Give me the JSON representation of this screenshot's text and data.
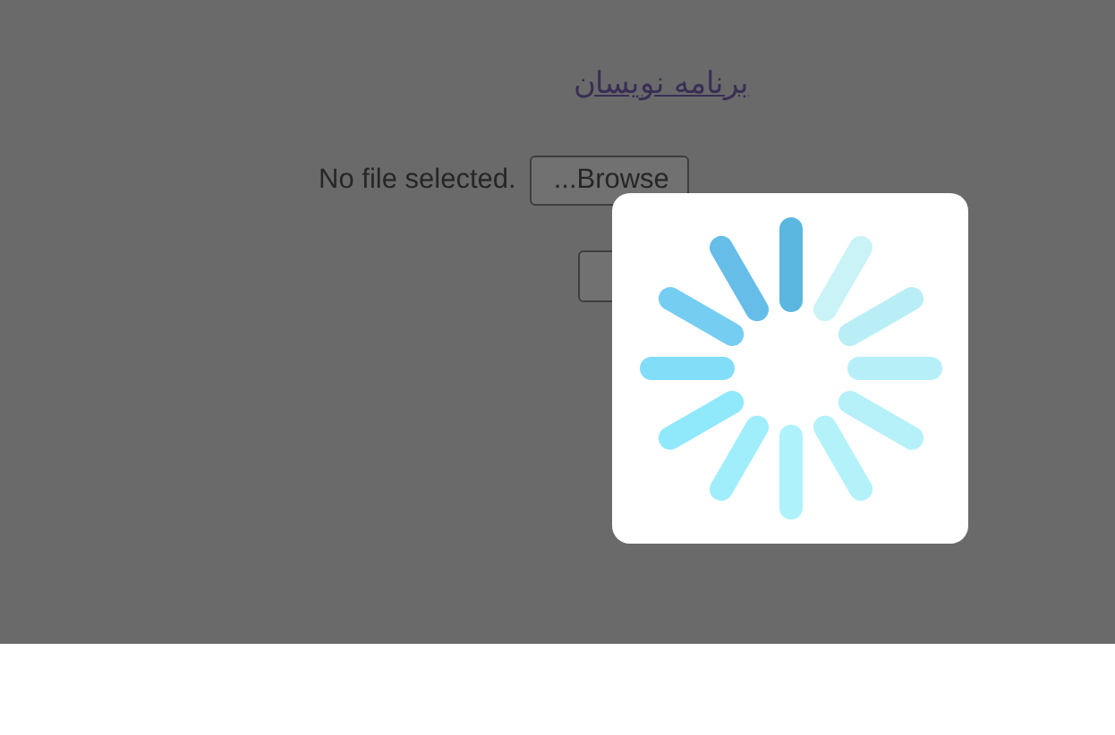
{
  "header_link": "برنامه نویسان",
  "file_input": {
    "status": "No file selected.",
    "button": "...Browse"
  },
  "loading": {
    "visible": true
  }
}
